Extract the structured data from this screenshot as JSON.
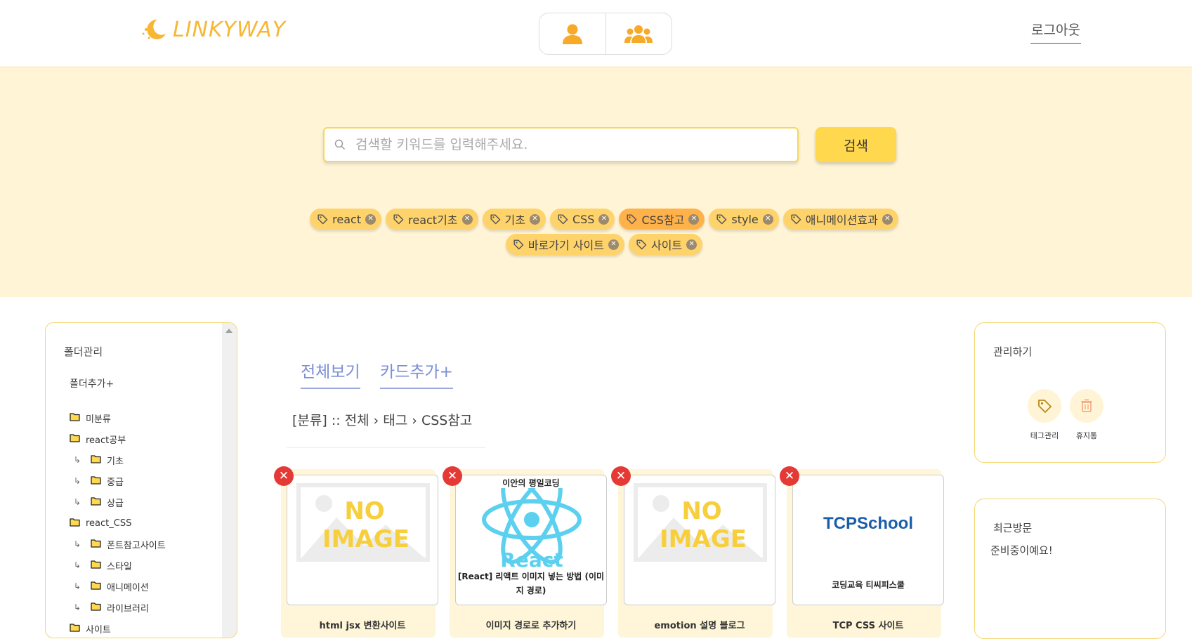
{
  "header": {
    "logo_text": "LINKYWAY",
    "logout_label": "로그아웃",
    "modes": [
      {
        "name": "person-icon"
      },
      {
        "name": "group-icon"
      }
    ]
  },
  "search": {
    "placeholder": "검색할 키워드를 입력해주세요.",
    "button_label": "검색"
  },
  "tags": [
    {
      "label": "react",
      "active": false
    },
    {
      "label": "react기초",
      "active": false
    },
    {
      "label": "기초",
      "active": false
    },
    {
      "label": "CSS",
      "active": false
    },
    {
      "label": "CSS참고",
      "active": true
    },
    {
      "label": "style",
      "active": false
    },
    {
      "label": "애니메이션효과",
      "active": false
    },
    {
      "label": "바로가기 사이트",
      "active": false
    },
    {
      "label": "사이트",
      "active": false
    }
  ],
  "folder_panel": {
    "title": "폴더관리",
    "add_label": "폴더추가+",
    "items": [
      {
        "label": "미분류",
        "child": false
      },
      {
        "label": "react공부",
        "child": false
      },
      {
        "label": "기초",
        "child": true
      },
      {
        "label": "중급",
        "child": true
      },
      {
        "label": "상급",
        "child": true
      },
      {
        "label": "react_CSS",
        "child": false
      },
      {
        "label": "폰트참고사이트",
        "child": true
      },
      {
        "label": "스타일",
        "child": true
      },
      {
        "label": "애니메이션",
        "child": true
      },
      {
        "label": "라이브러리",
        "child": true
      },
      {
        "label": "사이트",
        "child": false
      }
    ],
    "child_arrow": "↳"
  },
  "main": {
    "tab_all": "전체보기",
    "tab_add_card": "카드추가+",
    "breadcrumb": "[분류] :: 전체 › 태그 › CSS참고",
    "cards": [
      {
        "title": "html jsx 변환사이트",
        "image": "NO IMAGE"
      },
      {
        "title": "이미지 경로로 추가하기",
        "image_top": "이안의 평일코딩",
        "image_logo": "React",
        "image_caption": "[React] 리액트 이미지 넣는 방법 (이미지 경로)"
      },
      {
        "title": "emotion 설명 블로그",
        "image": "NO IMAGE"
      },
      {
        "title": "TCP CSS 사이트",
        "image_logo": "TCPSchool",
        "image_caption": "코딩교육 티씨피스쿨"
      }
    ],
    "delete_symbol": "✕"
  },
  "manage_panel": {
    "title": "관리하기",
    "tag_manage_label": "태그관리",
    "trash_label": "휴지통"
  },
  "recent_panel": {
    "title": "최근방문",
    "text": "준비중이예요!"
  },
  "colors": {
    "accent_yellow": "#ffd84d",
    "band_bg": "#fff4d6",
    "tag_bg": "#ffd36b",
    "tag_active_bg": "#ffb24a",
    "tab_blue": "#7b8fd6",
    "delete_red": "#e53935",
    "icon_orange": "#f7a928"
  }
}
